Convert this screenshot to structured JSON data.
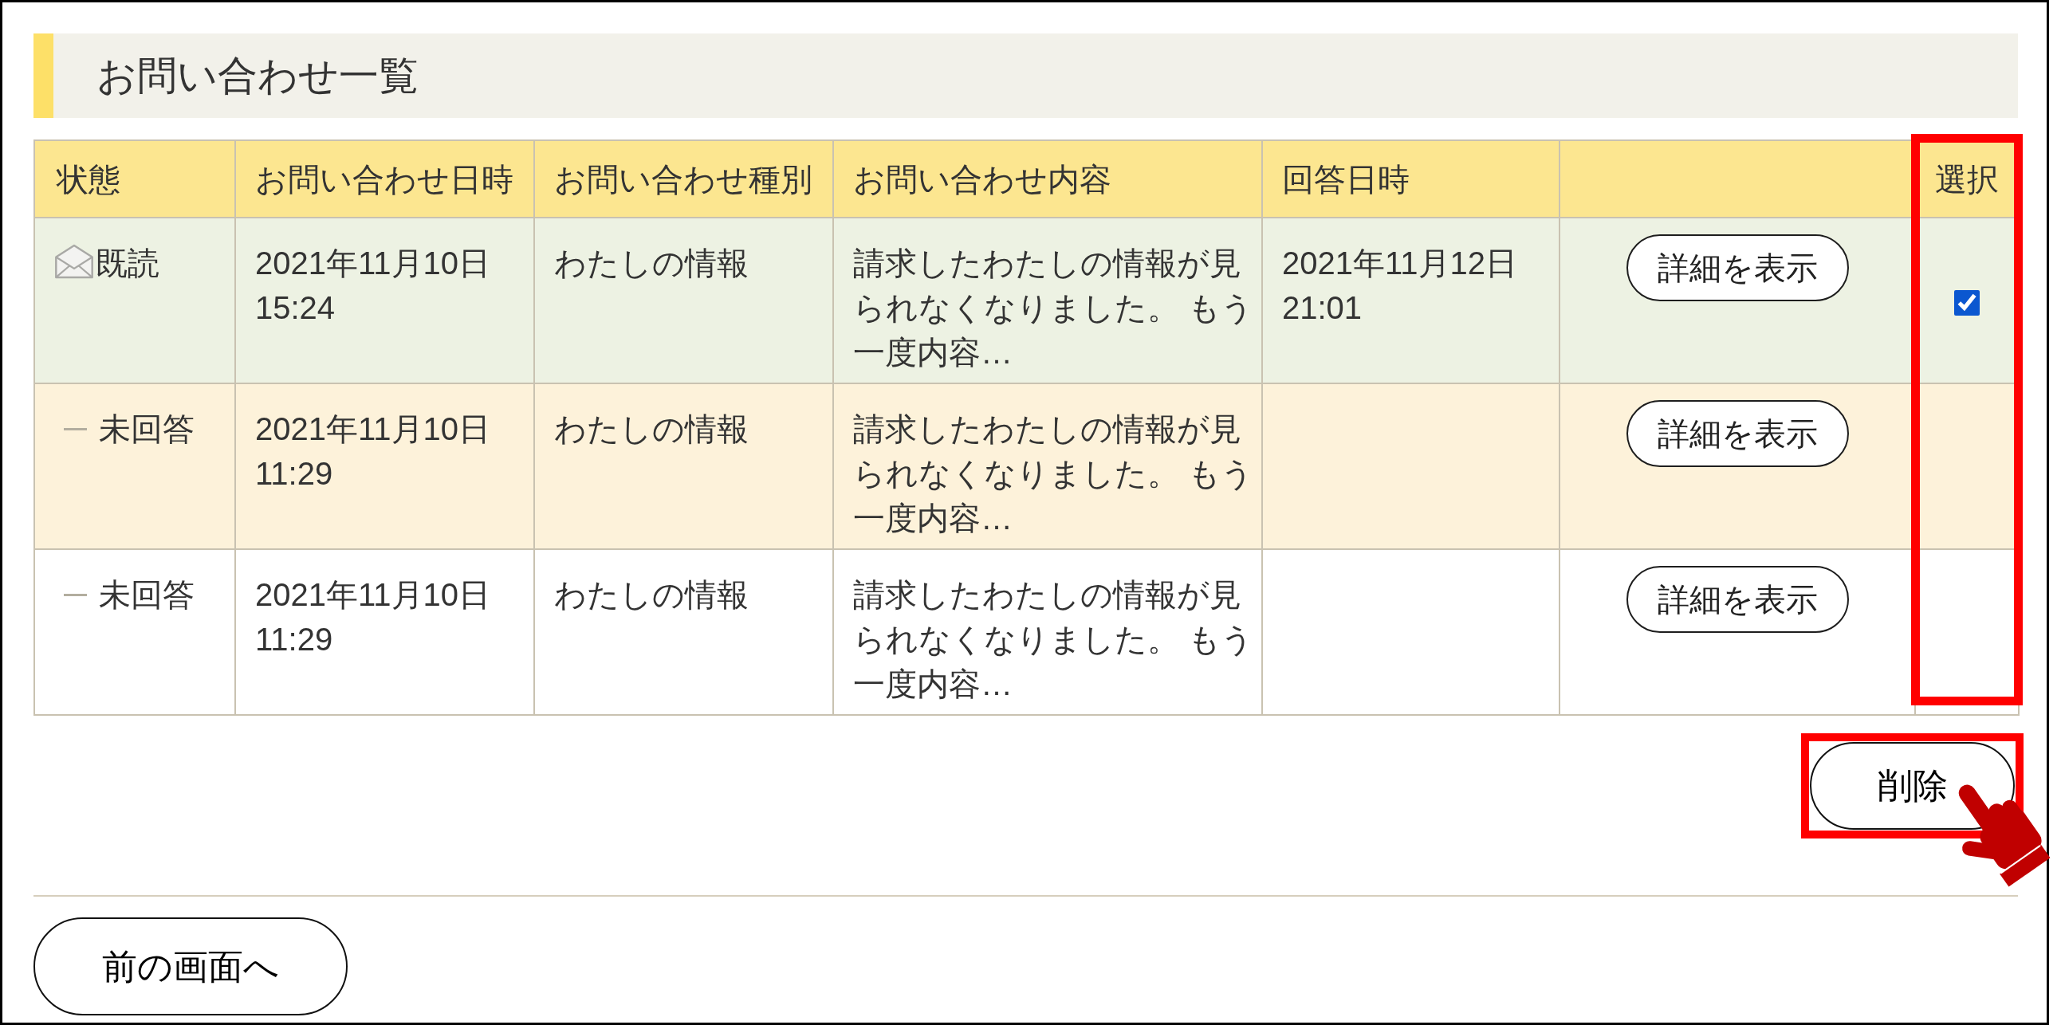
{
  "section": {
    "title": "お問い合わせ一覧"
  },
  "table": {
    "columns": [
      {
        "label": "状態",
        "highlighted": false
      },
      {
        "label": "お問い合わせ日時",
        "highlighted": false
      },
      {
        "label": "お問い合わせ種別",
        "highlighted": false
      },
      {
        "label": "お問い合わせ内容",
        "highlighted": false
      },
      {
        "label": "回答日時",
        "highlighted": false
      },
      {
        "highlighted": false
      },
      {
        "label": "選択",
        "highlighted": true
      }
    ],
    "rows": [
      {
        "color": "#edf2e3",
        "status": {
          "kind": "read",
          "label": "既読"
        },
        "inquiry_datetime": "2021年11月10日 15:24",
        "inquiry_type": "わたしの情報",
        "inquiry_content": "請求したわたしの情報が見られなくなりました。 もう一度内容…",
        "answer_datetime": "2021年11月12日 21:01",
        "detail_button": "詳細を表示",
        "checkbox": {
          "checked": true
        }
      },
      {
        "color": "#fdf2da",
        "status": {
          "kind": "unanswered",
          "label": "未回答"
        },
        "inquiry_datetime": "2021年11月10日 11:29",
        "inquiry_type": "わたしの情報",
        "inquiry_content": "請求したわたしの情報が見られなくなりました。 もう一度内容…",
        "detail_button": "詳細を表示"
      },
      {
        "color": "#ffffff",
        "status": {
          "kind": "unanswered",
          "label": "未回答"
        },
        "inquiry_datetime": "2021年11月10日 11:29",
        "inquiry_type": "わたしの情報",
        "inquiry_content": "請求したわたしの情報が見られなくなりました。 もう一度内容…",
        "detail_button": "詳細を表示"
      }
    ]
  },
  "delete_button": {
    "label": "削除",
    "highlighted": true,
    "pointed_at": true
  },
  "back_button": {
    "label": "前の画面へ",
    "highlighted": false,
    "pointed_at": false
  }
}
